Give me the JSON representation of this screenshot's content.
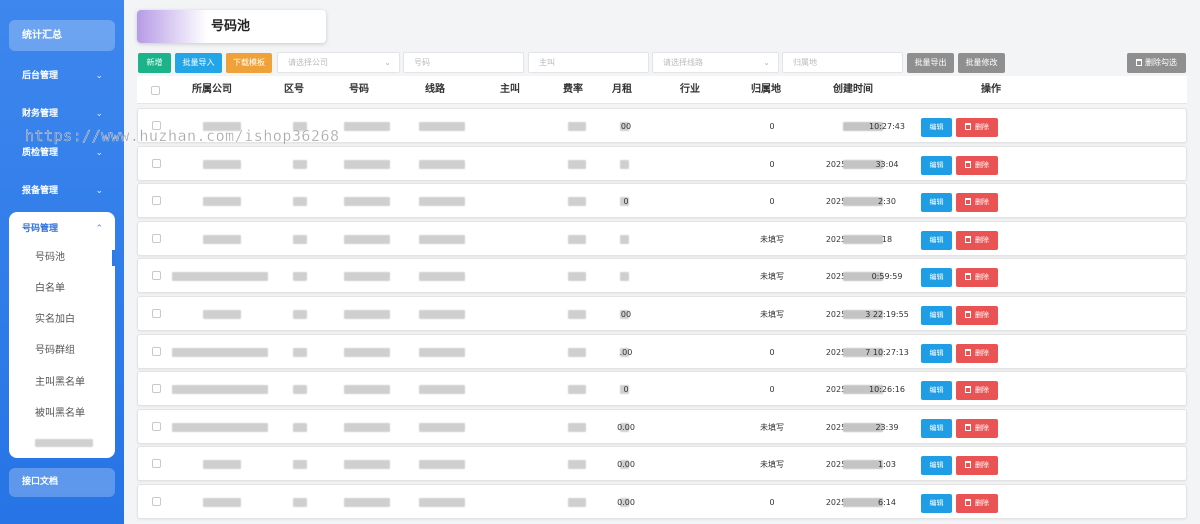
{
  "sidebar": {
    "top_item": "统计汇总",
    "items": [
      {
        "label": "后台管理",
        "chevron": "chevron-down-icon"
      },
      {
        "label": "财务管理",
        "chevron": "chevron-down-icon"
      },
      {
        "label": "质检管理",
        "chevron": "chevron-down-icon"
      },
      {
        "label": "报备管理",
        "chevron": "chevron-down-icon"
      }
    ],
    "open_group": {
      "label": "号码管理",
      "chevron": "chevron-up-icon",
      "sub_items": [
        "号码池",
        "白名单",
        "实名加白",
        "号码群组",
        "主叫黑名单",
        "被叫黑名单"
      ],
      "active": "号码池"
    },
    "bottom_item": "接口文档"
  },
  "tab": {
    "title": "号码池"
  },
  "toolbar": {
    "add": "新增",
    "import": "批量导入",
    "download_template": "下载模板",
    "company_placeholder": "请选择公司",
    "number_placeholder": "号码",
    "caller_placeholder": "主叫",
    "line_placeholder": "请选择线路",
    "region_placeholder": "归属地",
    "export": "批量导出",
    "batch_edit": "批量修改",
    "delete_selected": "删除勾选"
  },
  "table": {
    "columns": [
      "所属公司",
      "区号",
      "号码",
      "线路",
      "主叫",
      "费率",
      "月租",
      "行业",
      "归属地",
      "创建时间",
      "操作"
    ],
    "edit_label": "编辑",
    "delete_label": "删除",
    "rows": [
      {
        "rent": "00",
        "region": "0",
        "time": "10:27:43",
        "year": ""
      },
      {
        "rent": "",
        "region": "0",
        "time": "33:04",
        "year": "2025"
      },
      {
        "rent": "0",
        "region": "0",
        "time": "2:30",
        "year": "2025"
      },
      {
        "rent": "",
        "region": "未填写",
        "time": "18",
        "year": "2025"
      },
      {
        "rent": "",
        "region": "未填写",
        "time": "0:59:59",
        "year": "2025"
      },
      {
        "rent": "00",
        "region": "未填写",
        "time": "3 22:19:55",
        "year": "2025"
      },
      {
        "rent": ".00",
        "region": "0",
        "time": "7 10:27:13",
        "year": "2025"
      },
      {
        "rent": "0",
        "region": "0",
        "time": "10:26:16",
        "year": "2025"
      },
      {
        "rent": "0.00",
        "region": "未填写",
        "time": "23:39",
        "year": "2025"
      },
      {
        "rent": "0.00",
        "region": "未填写",
        "time": "1:03",
        "year": "2025"
      },
      {
        "rent": "0.00",
        "region": "0",
        "time": "6:14",
        "year": "2025"
      }
    ]
  },
  "watermark": "https://www.huzhan.com/ishop36268"
}
